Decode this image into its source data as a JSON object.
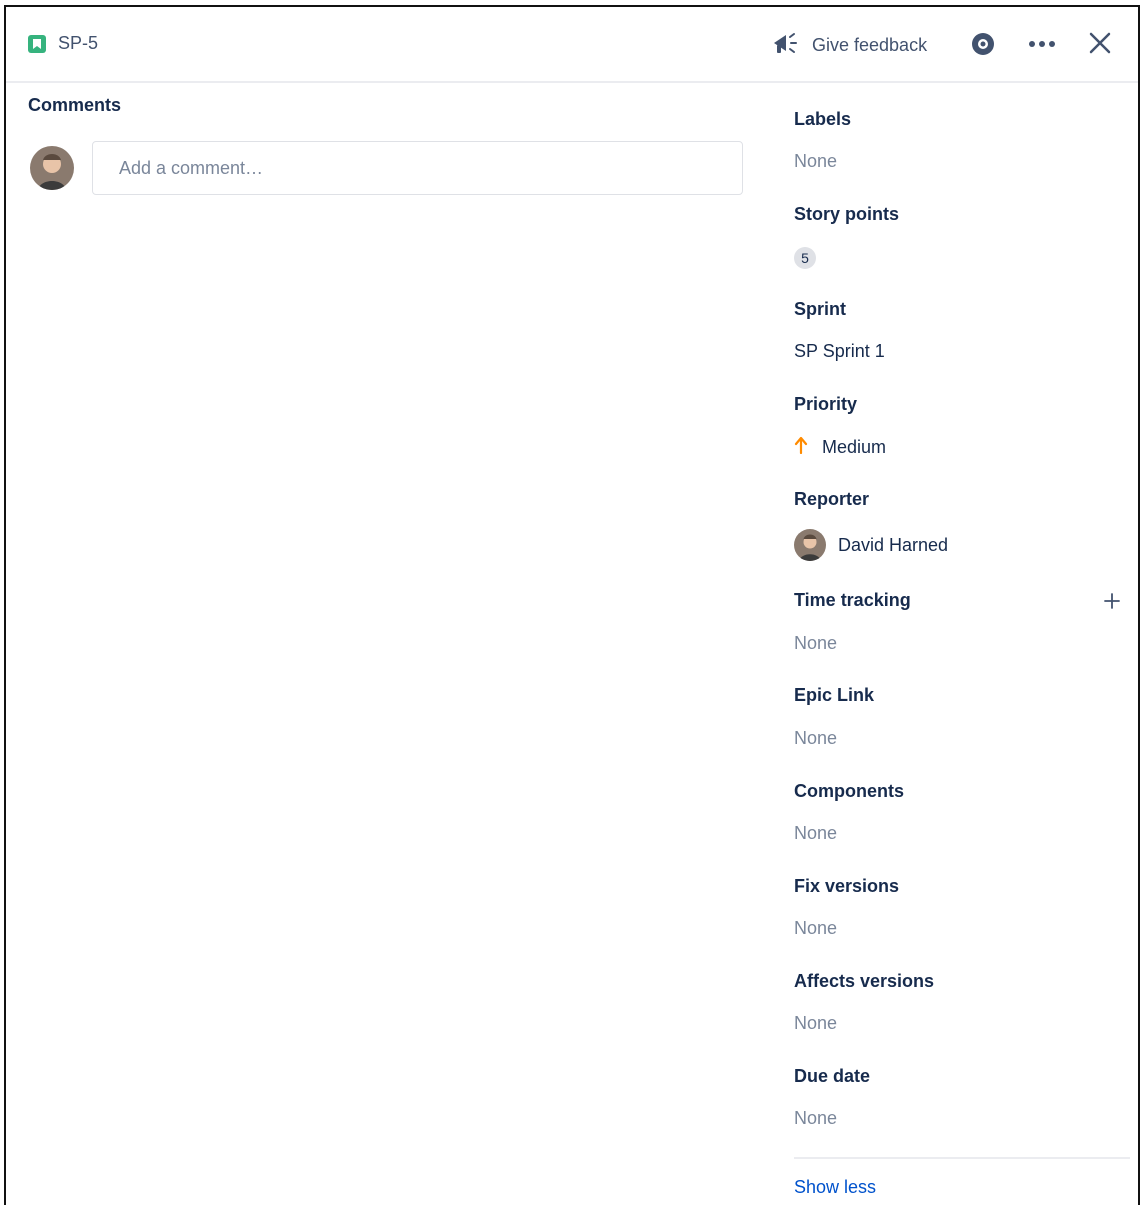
{
  "header": {
    "issue_key": "SP-5",
    "feedback_label": "Give feedback",
    "icons": {
      "issue_type": "story-icon",
      "feedback": "megaphone-icon",
      "watch": "eye-icon",
      "more": "more-icon",
      "close": "close-icon"
    }
  },
  "comments": {
    "heading": "Comments",
    "placeholder": "Add a comment…"
  },
  "fields": {
    "labels": {
      "label": "Labels",
      "value": "None"
    },
    "story_points": {
      "label": "Story points",
      "value": "5"
    },
    "sprint": {
      "label": "Sprint",
      "value": "SP Sprint 1"
    },
    "priority": {
      "label": "Priority",
      "value": "Medium",
      "color": "#ff8b00"
    },
    "reporter": {
      "label": "Reporter",
      "value": "David Harned"
    },
    "time_tracking": {
      "label": "Time tracking",
      "value": "None"
    },
    "epic_link": {
      "label": "Epic Link",
      "value": "None"
    },
    "components": {
      "label": "Components",
      "value": "None"
    },
    "fix_versions": {
      "label": "Fix versions",
      "value": "None"
    },
    "affects_versions": {
      "label": "Affects versions",
      "value": "None"
    },
    "due_date": {
      "label": "Due date",
      "value": "None"
    }
  },
  "show_less": "Show less",
  "colors": {
    "accent": "#0052cc",
    "story": "#36b37e",
    "muted": "#7a869a",
    "text": "#172b4d"
  }
}
